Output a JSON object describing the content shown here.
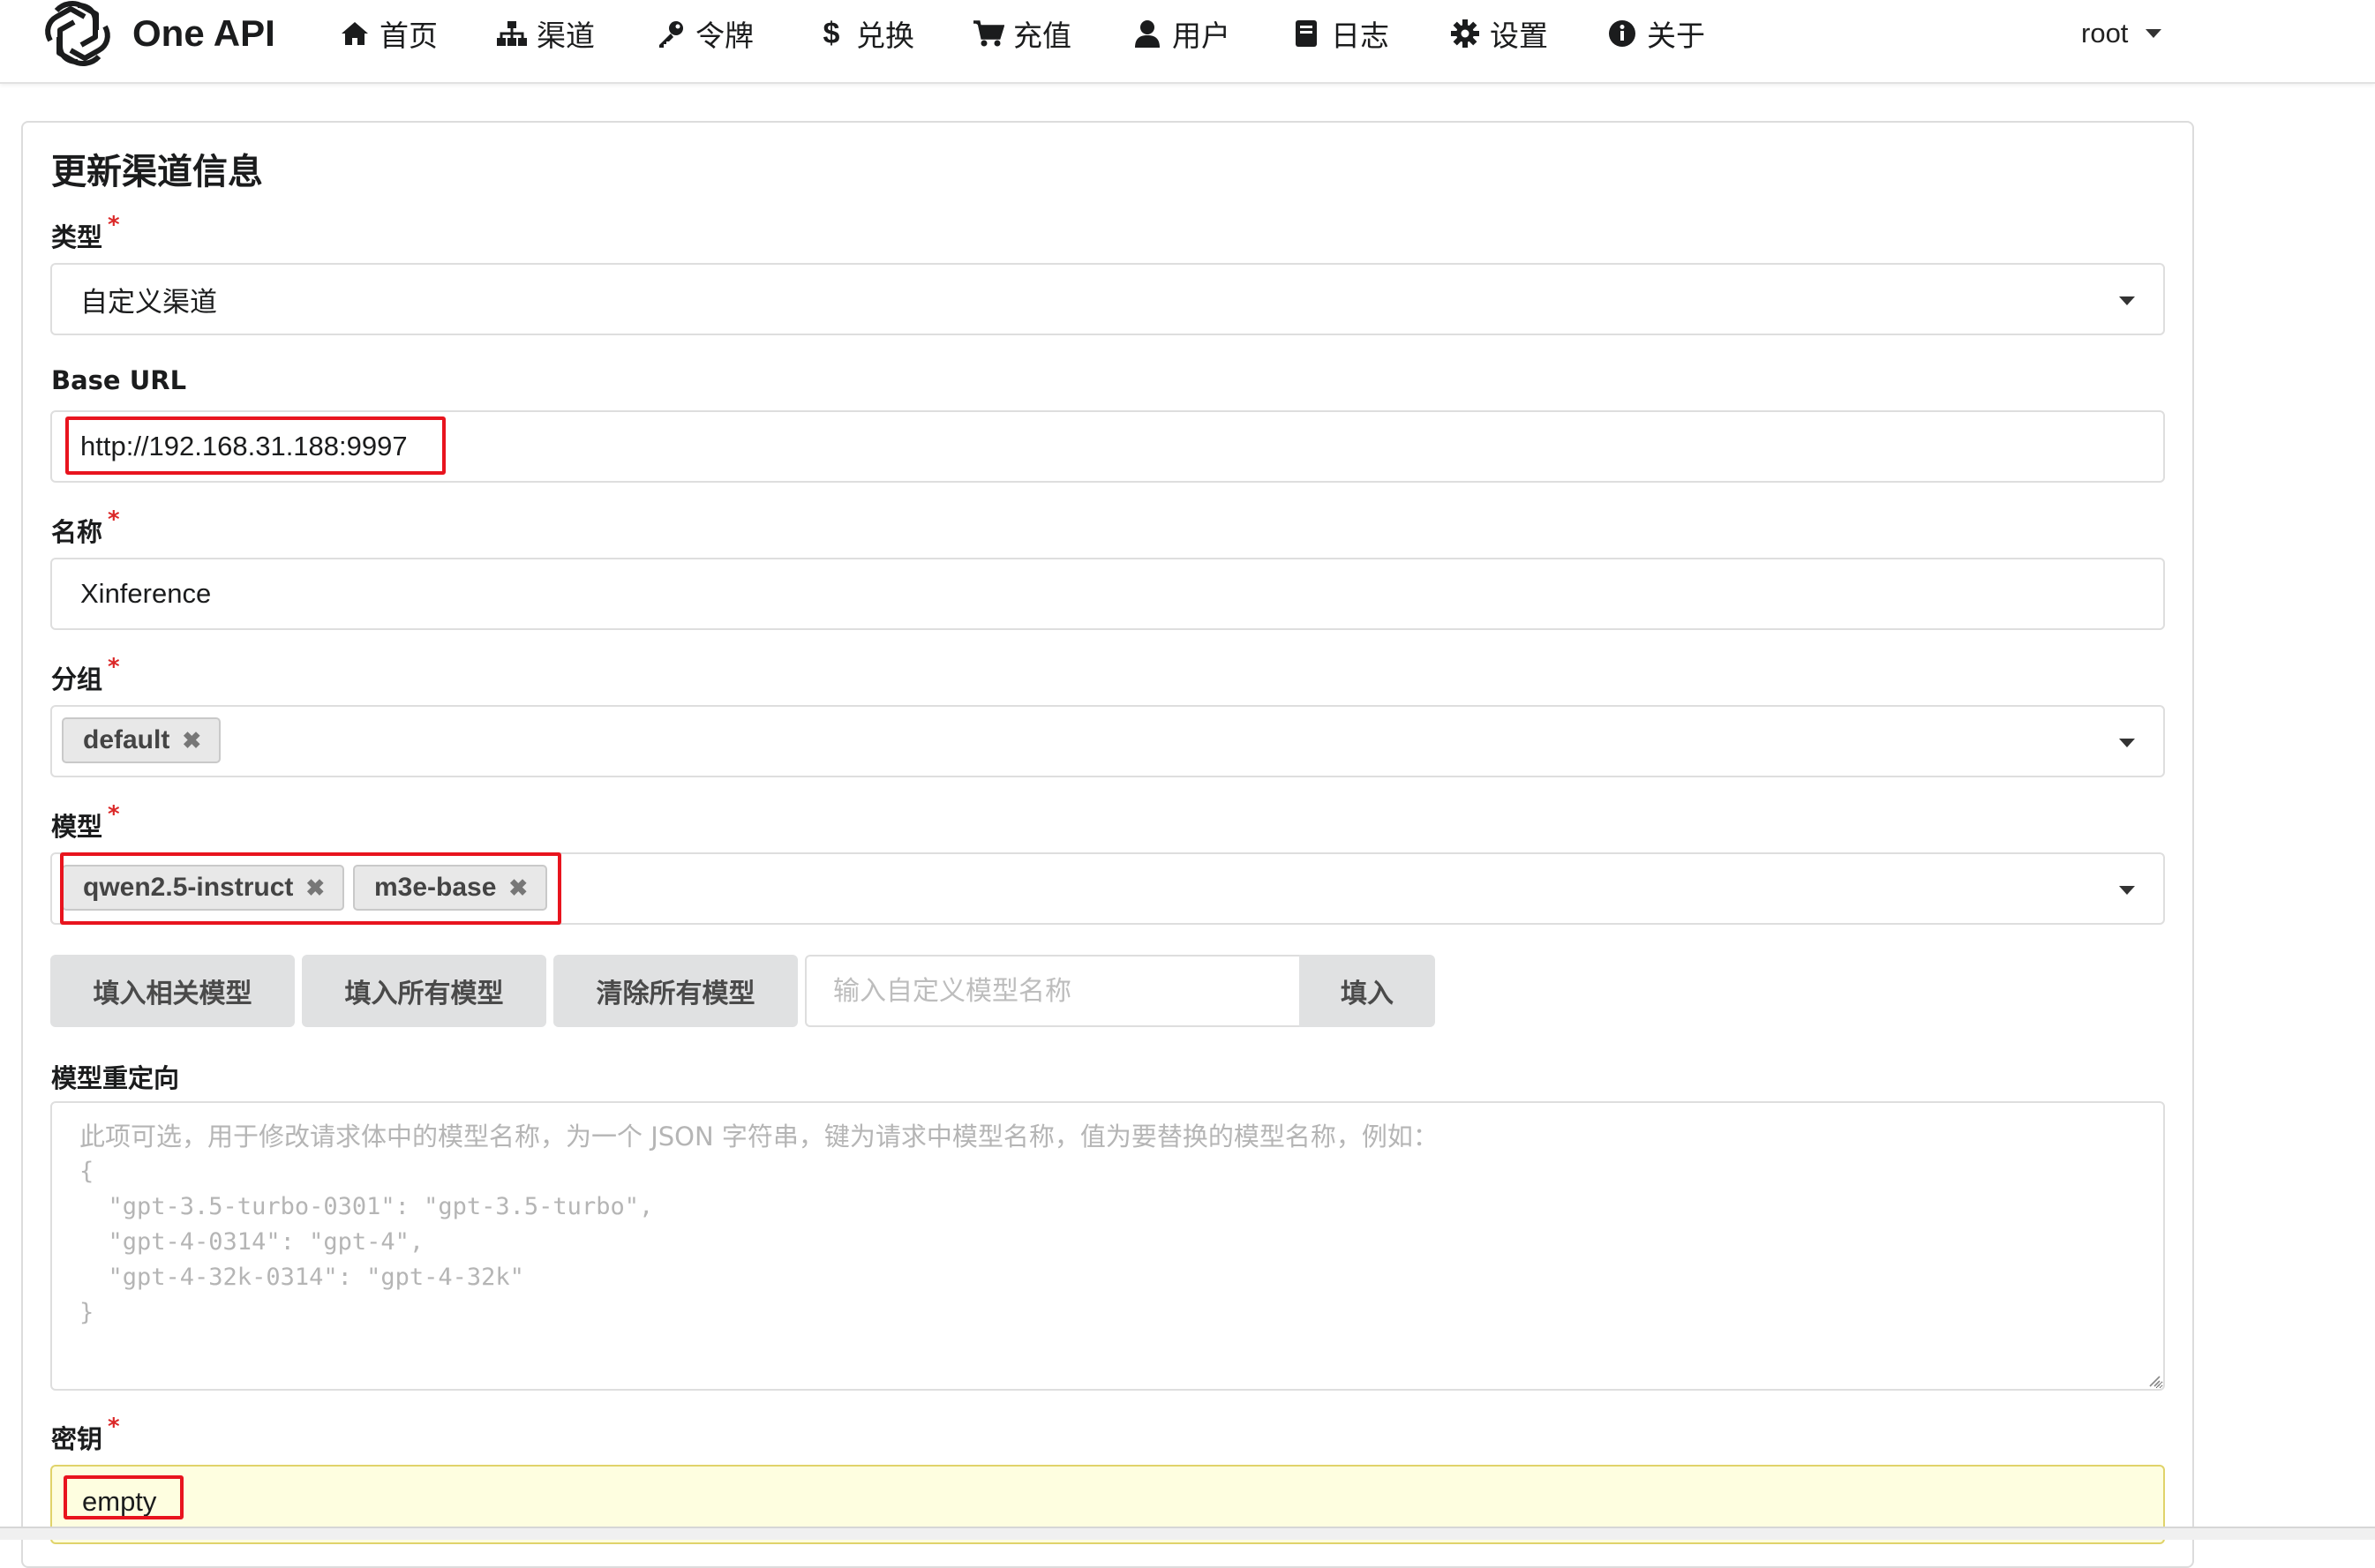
{
  "app": {
    "brand": "One API"
  },
  "nav": {
    "items": [
      {
        "label": "首页",
        "icon": "home-icon"
      },
      {
        "label": "渠道",
        "icon": "sitemap-icon"
      },
      {
        "label": "令牌",
        "icon": "key-icon"
      },
      {
        "label": "兑换",
        "icon": "dollar-icon"
      },
      {
        "label": "充值",
        "icon": "cart-icon"
      },
      {
        "label": "用户",
        "icon": "user-icon"
      },
      {
        "label": "日志",
        "icon": "book-icon"
      },
      {
        "label": "设置",
        "icon": "gear-icon"
      },
      {
        "label": "关于",
        "icon": "info-icon"
      }
    ],
    "user": "root"
  },
  "form": {
    "title": "更新渠道信息",
    "type": {
      "label": "类型",
      "required": "*",
      "value": "自定义渠道"
    },
    "base_url": {
      "label": "Base URL",
      "value": "http://192.168.31.188:9997"
    },
    "name": {
      "label": "名称",
      "required": "*",
      "value": "Xinference"
    },
    "group": {
      "label": "分组",
      "required": "*",
      "chips": [
        "default"
      ]
    },
    "models": {
      "label": "模型",
      "required": "*",
      "chips": [
        "qwen2.5-instruct",
        "m3e-base"
      ]
    },
    "buttons": {
      "fill_related": "填入相关模型",
      "fill_all": "填入所有模型",
      "clear_all": "清除所有模型",
      "fill": "填入"
    },
    "custom_model_placeholder": "输入自定义模型名称",
    "model_mapping": {
      "label": "模型重定向",
      "placeholder_line1": "此项可选，用于修改请求体中的模型名称，为一个 JSON 字符串，键为请求中模型名称，值为要替换的模型名称，例如：",
      "placeholder_code": "{\n  \"gpt-3.5-turbo-0301\": \"gpt-3.5-turbo\",\n  \"gpt-4-0314\": \"gpt-4\",\n  \"gpt-4-32k-0314\": \"gpt-4-32k\"\n}"
    },
    "key": {
      "label": "密钥",
      "required": "*",
      "value": "empty"
    }
  },
  "colors": {
    "highlight": "#e8141e",
    "required": "#db2828",
    "key_bg": "#fefee0"
  }
}
